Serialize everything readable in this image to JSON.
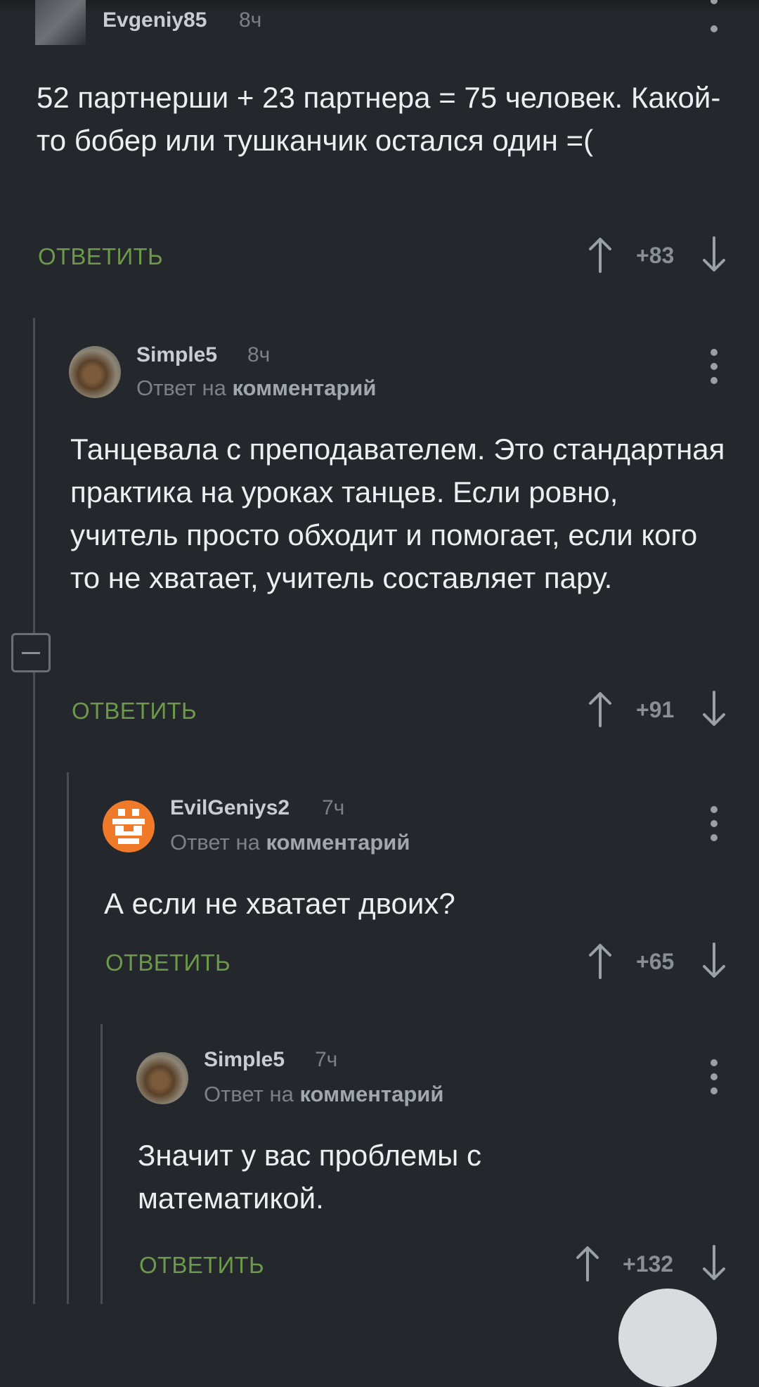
{
  "reply_label": "ОТВЕТИТЬ",
  "comments": [
    {
      "username": "Evgeniy85",
      "time": "8ч",
      "text": "52 партнерши + 23 партнера = 75 человек. Какой-то бобер или тушканчик остался один =(",
      "score": "+83"
    },
    {
      "username": "Simple5",
      "time": "8ч",
      "reply_prefix": "Ответ на",
      "reply_target": "комментарий",
      "text": "Танцевала с преподавателем. Это стандартная практика на уроках танцев. Если ровно, учитель просто обходит и помогает, если кого то не хватает, учитель составляет пару.",
      "score": "+91"
    },
    {
      "username": "EvilGeniys2",
      "time": "7ч",
      "reply_prefix": "Ответ на",
      "reply_target": "комментарий",
      "text": "А если не хватает двоих?",
      "score": "+65"
    },
    {
      "username": "Simple5",
      "time": "7ч",
      "reply_prefix": "Ответ на",
      "reply_target": "комментарий",
      "text": "Значит у вас проблемы с математикой.",
      "score": "+132"
    }
  ],
  "colors": {
    "background": "#24272b",
    "reply_green": "#6c9a4a",
    "thread_line": "#4a4e53"
  }
}
